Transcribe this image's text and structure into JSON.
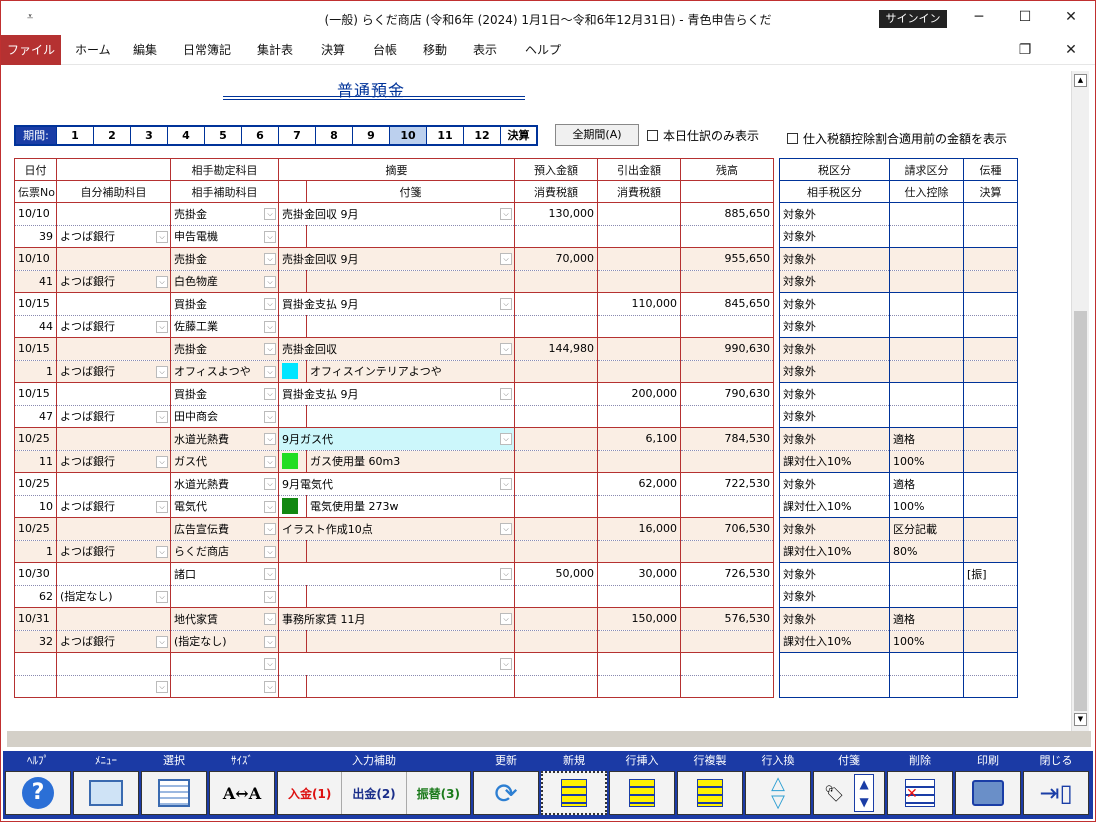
{
  "window": {
    "quick_access": "⩡",
    "title": "(一般) らくだ商店 (令和6年 (2024) 1月1日～令和6年12月31日)  -  青色申告らくだ",
    "signin": "サインイン",
    "minimize": "─",
    "maximize": "☐",
    "close": "✕",
    "restore": "❐",
    "close2": "✕"
  },
  "menu": [
    "ファイル",
    "ホーム",
    "編集",
    "日常簿記",
    "集計表",
    "決算",
    "台帳",
    "移動",
    "表示",
    "ヘルプ"
  ],
  "ledger": {
    "account_title": "普通預金",
    "period_label": "期間:",
    "periods": [
      "1",
      "2",
      "3",
      "4",
      "5",
      "6",
      "7",
      "8",
      "9",
      "10",
      "11",
      "12",
      "決算"
    ],
    "selected_period": "10",
    "all_period_button": "全期間(A)",
    "today_only_label": "本日仕訳のみ表示",
    "pre_tax_label": "仕入税額控除割合適用前の金額を表示"
  },
  "columns": {
    "row1": [
      "日付",
      "",
      "相手勘定科目",
      "摘要",
      "預入金額",
      "引出金額",
      "残高"
    ],
    "row2": [
      "伝票No",
      "自分補助科目",
      "相手補助科目",
      "",
      "付箋",
      "消費税額",
      "消費税額"
    ],
    "tax_row1": [
      "税区分",
      "請求区分",
      "伝種"
    ],
    "tax_row2": [
      "相手税区分",
      "仕入控除",
      "決算"
    ]
  },
  "entries": [
    {
      "date": "10/10",
      "no": "39",
      "sub": "よつば銀行",
      "acct": "売掛金",
      "acct_sub": "申告電機",
      "memo": "売掛金回収  9月",
      "tag": "",
      "tag_color": "",
      "deposit": "130,000",
      "withdraw": "",
      "balance": "885,650",
      "tax1": "対象外",
      "tax2": "対象外",
      "inv1": "",
      "inv2": "",
      "kind": "",
      "pink": false
    },
    {
      "date": "10/10",
      "no": "41",
      "sub": "よつば銀行",
      "acct": "売掛金",
      "acct_sub": "白色物産",
      "memo": "売掛金回収  9月",
      "tag": "",
      "tag_color": "",
      "deposit": "70,000",
      "withdraw": "",
      "balance": "955,650",
      "tax1": "対象外",
      "tax2": "対象外",
      "inv1": "",
      "inv2": "",
      "kind": "",
      "pink": true
    },
    {
      "date": "10/15",
      "no": "44",
      "sub": "よつば銀行",
      "acct": "買掛金",
      "acct_sub": "佐藤工業",
      "memo": "買掛金支払  9月",
      "tag": "",
      "tag_color": "",
      "deposit": "",
      "withdraw": "110,000",
      "balance": "845,650",
      "tax1": "対象外",
      "tax2": "対象外",
      "inv1": "",
      "inv2": "",
      "kind": "",
      "pink": false
    },
    {
      "date": "10/15",
      "no": "1",
      "sub": "よつば銀行",
      "acct": "売掛金",
      "acct_sub": "オフィスよつや",
      "memo": "売掛金回収",
      "tag": "オフィスインテリアよつや",
      "tag_color": "#00e5ff",
      "deposit": "144,980",
      "withdraw": "",
      "balance": "990,630",
      "tax1": "対象外",
      "tax2": "対象外",
      "inv1": "",
      "inv2": "",
      "kind": "",
      "pink": true
    },
    {
      "date": "10/15",
      "no": "47",
      "sub": "よつば銀行",
      "acct": "買掛金",
      "acct_sub": "田中商会",
      "memo": "買掛金支払  9月",
      "tag": "",
      "tag_color": "",
      "deposit": "",
      "withdraw": "200,000",
      "balance": "790,630",
      "tax1": "対象外",
      "tax2": "対象外",
      "inv1": "",
      "inv2": "",
      "kind": "",
      "pink": false
    },
    {
      "date": "10/25",
      "no": "11",
      "sub": "よつば銀行",
      "acct": "水道光熱費",
      "acct_sub": "ガス代",
      "memo": "9月ガス代",
      "tag": "ガス使用量  60m3",
      "tag_color": "#22dd22",
      "deposit": "",
      "withdraw": "6,100",
      "balance": "784,530",
      "tax1": "対象外",
      "tax2": "課対仕入10%",
      "inv1": "適格",
      "inv2": "100%",
      "kind": "",
      "pink": true,
      "memo_hl": true
    },
    {
      "date": "10/25",
      "no": "10",
      "sub": "よつば銀行",
      "acct": "水道光熱費",
      "acct_sub": "電気代",
      "memo": "9月電気代",
      "tag": "電気使用量  273w",
      "tag_color": "#118811",
      "deposit": "",
      "withdraw": "62,000",
      "balance": "722,530",
      "tax1": "対象外",
      "tax2": "課対仕入10%",
      "inv1": "適格",
      "inv2": "100%",
      "kind": "",
      "pink": false
    },
    {
      "date": "10/25",
      "no": "1",
      "sub": "よつば銀行",
      "acct": "広告宣伝費",
      "acct_sub": "らくだ商店",
      "memo": "イラスト作成10点",
      "tag": "",
      "tag_color": "",
      "deposit": "",
      "withdraw": "16,000",
      "balance": "706,530",
      "tax1": "対象外",
      "tax2": "課対仕入10%",
      "inv1": "区分記載",
      "inv2": "80%",
      "kind": "",
      "pink": true
    },
    {
      "date": "10/30",
      "no": "62",
      "sub": "(指定なし)",
      "acct": "諸口",
      "acct_sub": "",
      "memo": "",
      "tag": "",
      "tag_color": "",
      "deposit": "50,000",
      "withdraw": "30,000",
      "balance": "726,530",
      "tax1": "対象外",
      "tax2": "対象外",
      "inv1": "",
      "inv2": "",
      "kind": "[振]",
      "pink": false
    },
    {
      "date": "10/31",
      "no": "32",
      "sub": "よつば銀行",
      "acct": "地代家賃",
      "acct_sub": "(指定なし)",
      "memo": "事務所家賃  11月",
      "tag": "",
      "tag_color": "",
      "deposit": "",
      "withdraw": "150,000",
      "balance": "576,530",
      "tax1": "対象外",
      "tax2": "課対仕入10%",
      "inv1": "適格",
      "inv2": "100%",
      "kind": "",
      "pink": true
    }
  ],
  "toolbar": {
    "help": "ﾍﾙﾌﾟ",
    "menu": "ﾒﾆｭｰ",
    "select": "選択",
    "size": "ｻｲｽﾞ",
    "input_assist": "入力補助",
    "deposit": "入金(1)",
    "withdraw": "出金(2)",
    "transfer": "振替(3)",
    "refresh": "更新",
    "new": "新規",
    "insert_row": "行挿入",
    "copy_row": "行複製",
    "swap_row": "行入換",
    "tag": "付箋",
    "delete": "削除",
    "print": "印刷",
    "close": "閉じる",
    "help_glyph": "?",
    "size_glyph": "A↔A"
  }
}
